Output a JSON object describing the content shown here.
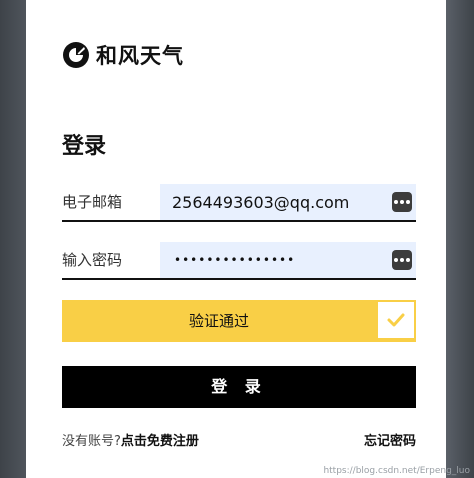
{
  "brand": {
    "name": "和风天气",
    "logo_icon": "hefeng-logo-icon"
  },
  "login_title": "登录",
  "email": {
    "label": "电子邮箱",
    "value": "2564493603@qq.com",
    "autofill_icon": "autofill-key-icon"
  },
  "password": {
    "label": "输入密码",
    "masked_value": "•••••••••••••••",
    "autofill_icon": "autofill-key-icon"
  },
  "verify": {
    "label": "验证通过",
    "check_icon": "checkmark-icon",
    "accent_color": "#f9cf46"
  },
  "login_button": {
    "label": "登 录"
  },
  "footer": {
    "no_account_text": "没有账号?",
    "register_link": "点击免费注册",
    "forgot_password": "忘记密码"
  },
  "watermark": "https://blog.csdn.net/Erpeng_luo"
}
